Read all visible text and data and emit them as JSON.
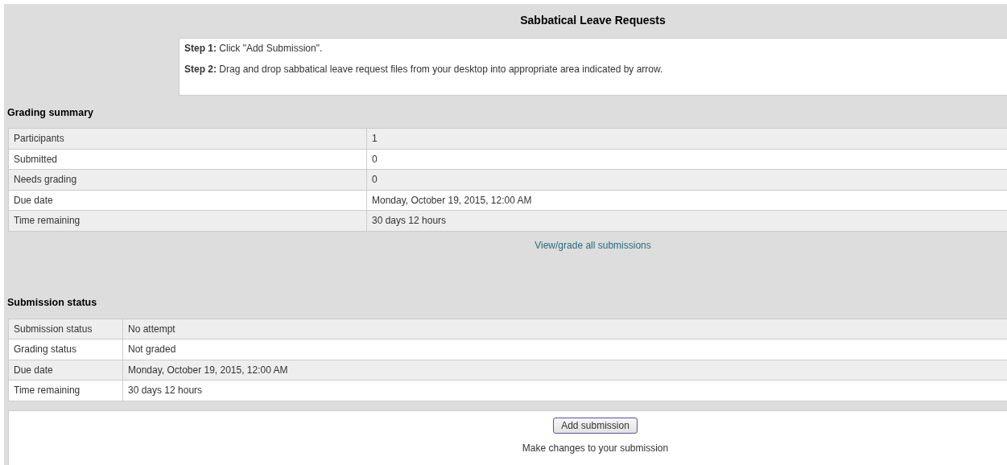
{
  "title": "Sabbatical Leave Requests",
  "intro": [
    "**Step 1:** Click \"Add Submission\".",
    "**Step 2:** Drag and drop sabbatical leave request files from your desktop into appropriate area indicated by arrow."
  ],
  "grading_summary": {
    "heading": "Grading summary",
    "rows": [
      {
        "label": "Participants",
        "value": "1"
      },
      {
        "label": "Submitted",
        "value": "0"
      },
      {
        "label": "Needs grading",
        "value": "0"
      },
      {
        "label": "Due date",
        "value": "Monday, October 19, 2015, 12:00 AM"
      },
      {
        "label": "Time remaining",
        "value": "30 days 12 hours"
      }
    ],
    "link": "View/grade all submissions"
  },
  "submission_status": {
    "heading": "Submission status",
    "rows": [
      {
        "label": "Submission status",
        "value": "No attempt"
      },
      {
        "label": "Grading status",
        "value": "Not graded"
      },
      {
        "label": "Due date",
        "value": "Monday, October 19, 2015, 12:00 AM"
      },
      {
        "label": "Time remaining",
        "value": "30 days 12 hours"
      }
    ]
  },
  "actions": {
    "button": "Add submission",
    "note": "Make changes to your submission"
  }
}
